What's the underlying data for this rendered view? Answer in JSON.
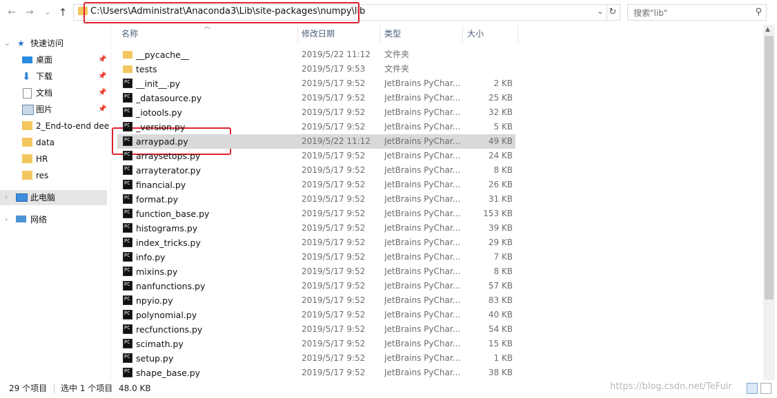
{
  "toolbar": {
    "back": "←",
    "forward": "→",
    "recent": "⌄",
    "up": "↑",
    "address": "C:\\Users\\Administrat\\Anaconda3\\Lib\\site-packages\\numpy\\lib",
    "refresh": "↻",
    "search_placeholder": "搜索\"lib\""
  },
  "sidebar": {
    "quick_access": "快速访问",
    "items": [
      {
        "label": "桌面",
        "icon": "desktop-icon",
        "pinned": true
      },
      {
        "label": "下载",
        "icon": "download-icon",
        "pinned": true
      },
      {
        "label": "文档",
        "icon": "document-icon",
        "pinned": true
      },
      {
        "label": "图片",
        "icon": "picture-icon",
        "pinned": true
      },
      {
        "label": "2_End-to-end dee",
        "icon": "folder-icon",
        "pinned": false
      },
      {
        "label": "data",
        "icon": "folder-icon",
        "pinned": false
      },
      {
        "label": "HR",
        "icon": "folder-icon",
        "pinned": false
      },
      {
        "label": "res",
        "icon": "folder-icon",
        "pinned": false
      }
    ],
    "this_pc": "此电脑",
    "network": "网络"
  },
  "columns": {
    "name": "名称",
    "date": "修改日期",
    "type": "类型",
    "size": "大小"
  },
  "files": [
    {
      "name": "__pycache__",
      "date": "2019/5/22 11:12",
      "type": "文件夹",
      "size": "",
      "kind": "folder"
    },
    {
      "name": "tests",
      "date": "2019/5/17 9:53",
      "type": "文件夹",
      "size": "",
      "kind": "folder"
    },
    {
      "name": "__init__.py",
      "date": "2019/5/17 9:52",
      "type": "JetBrains PyChar...",
      "size": "2 KB",
      "kind": "py"
    },
    {
      "name": "_datasource.py",
      "date": "2019/5/17 9:52",
      "type": "JetBrains PyChar...",
      "size": "25 KB",
      "kind": "py"
    },
    {
      "name": "_iotools.py",
      "date": "2019/5/17 9:52",
      "type": "JetBrains PyChar...",
      "size": "32 KB",
      "kind": "py"
    },
    {
      "name": "_version.py",
      "date": "2019/5/17 9:52",
      "type": "JetBrains PyChar...",
      "size": "5 KB",
      "kind": "py"
    },
    {
      "name": "arraypad.py",
      "date": "2019/5/22 11:12",
      "type": "JetBrains PyChar...",
      "size": "49 KB",
      "kind": "py",
      "selected": true
    },
    {
      "name": "arraysetops.py",
      "date": "2019/5/17 9:52",
      "type": "JetBrains PyChar...",
      "size": "24 KB",
      "kind": "py"
    },
    {
      "name": "arrayterator.py",
      "date": "2019/5/17 9:52",
      "type": "JetBrains PyChar...",
      "size": "8 KB",
      "kind": "py"
    },
    {
      "name": "financial.py",
      "date": "2019/5/17 9:52",
      "type": "JetBrains PyChar...",
      "size": "26 KB",
      "kind": "py"
    },
    {
      "name": "format.py",
      "date": "2019/5/17 9:52",
      "type": "JetBrains PyChar...",
      "size": "31 KB",
      "kind": "py"
    },
    {
      "name": "function_base.py",
      "date": "2019/5/17 9:52",
      "type": "JetBrains PyChar...",
      "size": "153 KB",
      "kind": "py"
    },
    {
      "name": "histograms.py",
      "date": "2019/5/17 9:52",
      "type": "JetBrains PyChar...",
      "size": "39 KB",
      "kind": "py"
    },
    {
      "name": "index_tricks.py",
      "date": "2019/5/17 9:52",
      "type": "JetBrains PyChar...",
      "size": "29 KB",
      "kind": "py"
    },
    {
      "name": "info.py",
      "date": "2019/5/17 9:52",
      "type": "JetBrains PyChar...",
      "size": "7 KB",
      "kind": "py"
    },
    {
      "name": "mixins.py",
      "date": "2019/5/17 9:52",
      "type": "JetBrains PyChar...",
      "size": "8 KB",
      "kind": "py"
    },
    {
      "name": "nanfunctions.py",
      "date": "2019/5/17 9:52",
      "type": "JetBrains PyChar...",
      "size": "57 KB",
      "kind": "py"
    },
    {
      "name": "npyio.py",
      "date": "2019/5/17 9:52",
      "type": "JetBrains PyChar...",
      "size": "83 KB",
      "kind": "py"
    },
    {
      "name": "polynomial.py",
      "date": "2019/5/17 9:52",
      "type": "JetBrains PyChar...",
      "size": "40 KB",
      "kind": "py"
    },
    {
      "name": "recfunctions.py",
      "date": "2019/5/17 9:52",
      "type": "JetBrains PyChar...",
      "size": "54 KB",
      "kind": "py"
    },
    {
      "name": "scimath.py",
      "date": "2019/5/17 9:52",
      "type": "JetBrains PyChar...",
      "size": "15 KB",
      "kind": "py"
    },
    {
      "name": "setup.py",
      "date": "2019/5/17 9:52",
      "type": "JetBrains PyChar...",
      "size": "1 KB",
      "kind": "py"
    },
    {
      "name": "shape_base.py",
      "date": "2019/5/17 9:52",
      "type": "JetBrains PyChar...",
      "size": "38 KB",
      "kind": "py"
    }
  ],
  "status": {
    "count": "29 个项目",
    "selection": "选中 1 个项目",
    "size": "48.0 KB"
  },
  "watermark": "https://blog.csdn.net/TeFuir",
  "colors": {
    "highlight_box": "#e0202c",
    "selected_row": "#d9d9d9",
    "folder": "#f3c75f"
  }
}
